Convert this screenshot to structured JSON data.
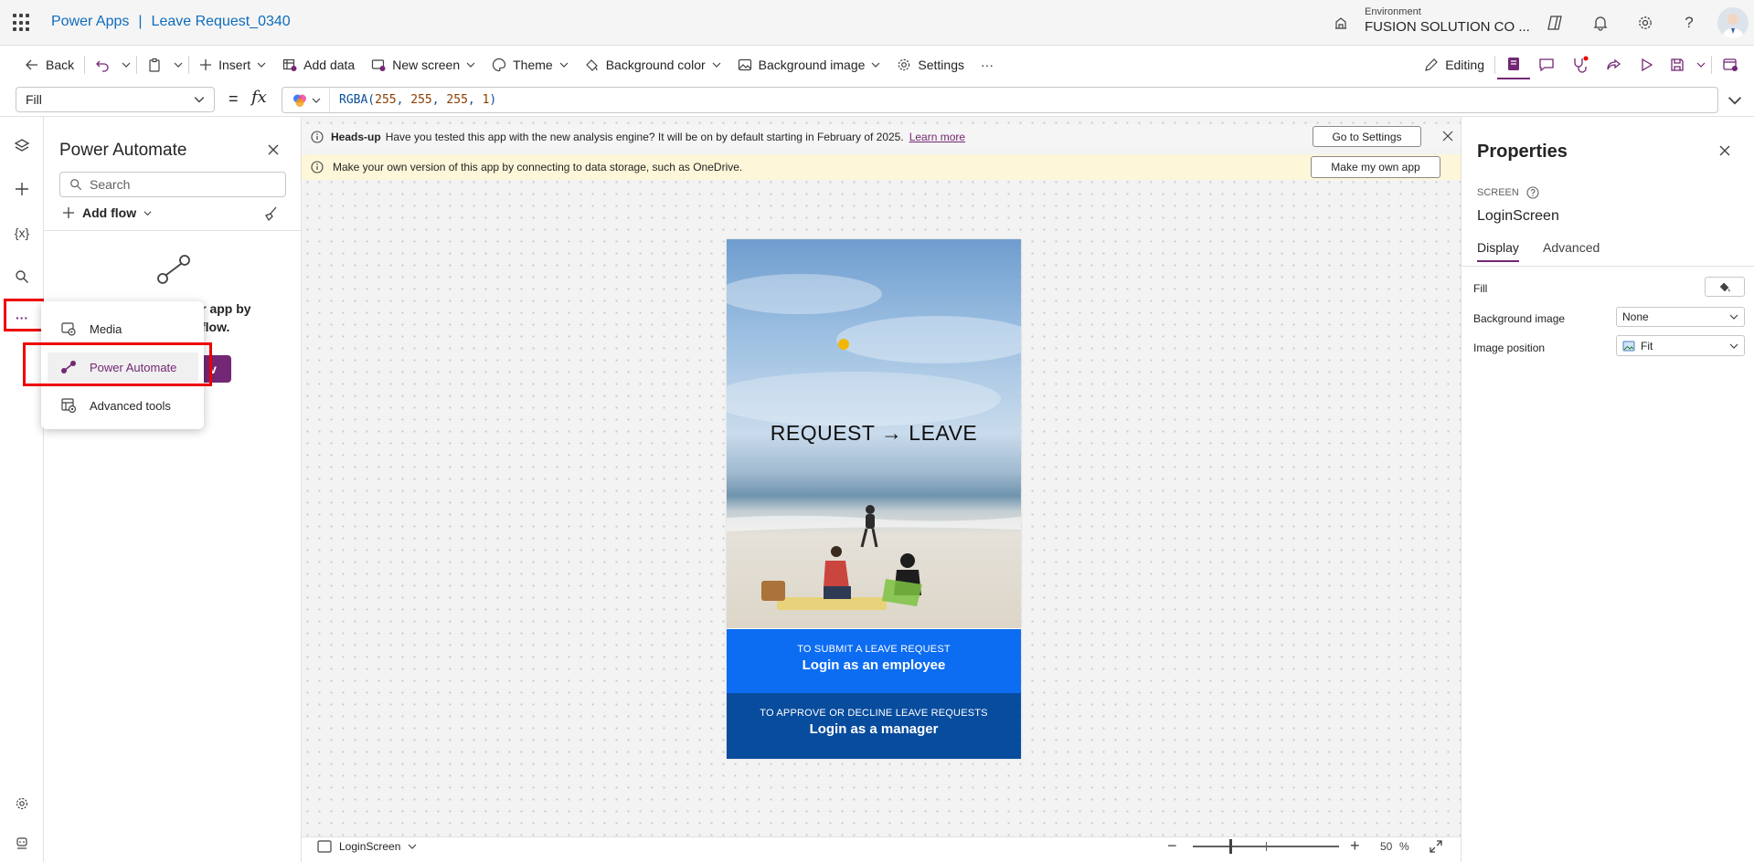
{
  "header": {
    "product": "Power Apps",
    "separator": "|",
    "app_name": "Leave Request_0340",
    "env_label": "Environment",
    "env_name": "FUSION SOLUTION CO ..."
  },
  "toolbar": {
    "back": "Back",
    "insert": "Insert",
    "add_data": "Add data",
    "new_screen": "New screen",
    "theme": "Theme",
    "background_color": "Background color",
    "background_image": "Background image",
    "settings": "Settings",
    "more": "···",
    "editing": "Editing"
  },
  "formula": {
    "property": "Fill",
    "equals": "=",
    "fx": "fx",
    "fn": "RGBA(",
    "args": [
      "255",
      "255",
      "255",
      "1"
    ],
    "close": ")"
  },
  "rail": {
    "variables": "{x}",
    "more": "···"
  },
  "pa_pane": {
    "title": "Power Automate",
    "search_placeholder": "Search",
    "add_flow": "Add flow",
    "text_line1": "our app by",
    "text_line2": "flow.",
    "button_partial": "v"
  },
  "popup_menu": {
    "items": [
      "Media",
      "Power Automate",
      "Advanced tools"
    ]
  },
  "banners": {
    "headsup_bold": "Heads-up",
    "headsup_text": "Have you tested this app with the new analysis engine? It will be on by default starting in February of 2025.",
    "headsup_link": "Learn more",
    "go_settings": "Go to Settings",
    "myown_text": "Make your own version of this app by connecting to data storage, such as OneDrive.",
    "myown_button": "Make my own app"
  },
  "app_preview": {
    "title": "REQUEST → LEAVE",
    "employee_caption": "TO SUBMIT A LEAVE REQUEST",
    "employee_button": "Login as an employee",
    "manager_caption": "TO APPROVE OR DECLINE LEAVE REQUESTS",
    "manager_button": "Login as a manager"
  },
  "bottom": {
    "screen": "LoginScreen",
    "zoom": "50",
    "zoom_unit": "%"
  },
  "properties": {
    "title": "Properties",
    "type": "SCREEN",
    "name": "LoginScreen",
    "tabs": [
      "Display",
      "Advanced"
    ],
    "fill_label": "Fill",
    "bg_image_label": "Background image",
    "bg_image_value": "None",
    "image_position_label": "Image position",
    "image_position_value": "Fit"
  },
  "colors": {
    "brand_purple": "#742774",
    "link_blue": "#0f6cbd",
    "highlight_red": "#ee0000",
    "employee_panel": "#0c6cf2",
    "manager_panel": "#084c9e"
  }
}
